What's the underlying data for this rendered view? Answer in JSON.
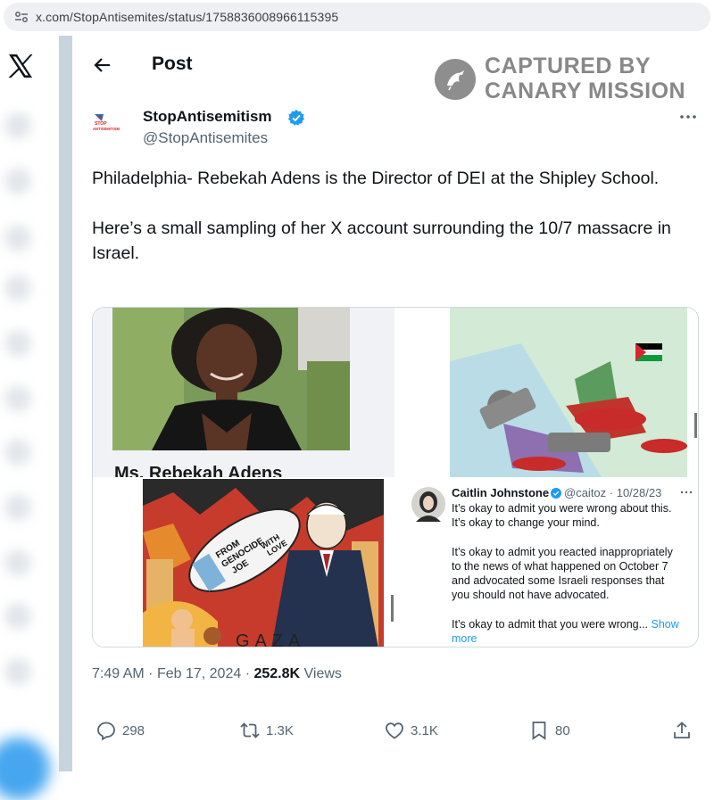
{
  "browser": {
    "url": "x.com/StopAntisemites/status/1758836008966115395"
  },
  "header": {
    "title": "Post"
  },
  "watermark": {
    "line1": "CAPTURED BY",
    "line2": "CANARY MISSION"
  },
  "author": {
    "name": "StopAntisemitism",
    "handle": "@StopAntisemites",
    "avatar_text_1": "STOP",
    "avatar_text_2": "ANTISEMITISM"
  },
  "tweet": {
    "text": "Philadelphia- Rebekah Adens is the Director of DEI at the Shipley School.\n\nHere’s a small sampling of her X account surrounding the 10/7 massacre in Israel."
  },
  "media": {
    "photo_caption_partial": "Ms. Rebekah Adens",
    "cartoon_text_1": "FROM",
    "cartoon_text_2": "GENOCIDE",
    "cartoon_text_3": "JOE",
    "cartoon_text_4": "WITH",
    "cartoon_text_5": "LOVE",
    "cartoon_text_6": "GAZA",
    "quoted": {
      "name": "Caitlin Johnstone",
      "meta": "@caitoz · 10/28/23",
      "body": "It’s okay to admit you were wrong about this.\nIt’s okay to change your mind.\n\nIt’s okay to admit you reacted inappropriately\nto the news of what happened on October 7\nand advocated some Israeli responses that\nyou should not have advocated.\n\nIt’s okay to admit that you were wrong... ",
      "show_more": "Show\nmore"
    }
  },
  "footer": {
    "time": "7:49 AM",
    "date": "Feb 17, 2024",
    "views_count": "252.8K",
    "views_label": "Views",
    "sep": "·"
  },
  "actions": {
    "replies": "298",
    "reposts": "1.3K",
    "likes": "3.1K",
    "bookmarks": "80"
  },
  "colors": {
    "link": "#1d9bf0",
    "secondary_text": "#536471",
    "verified": "#1d9bf0"
  }
}
